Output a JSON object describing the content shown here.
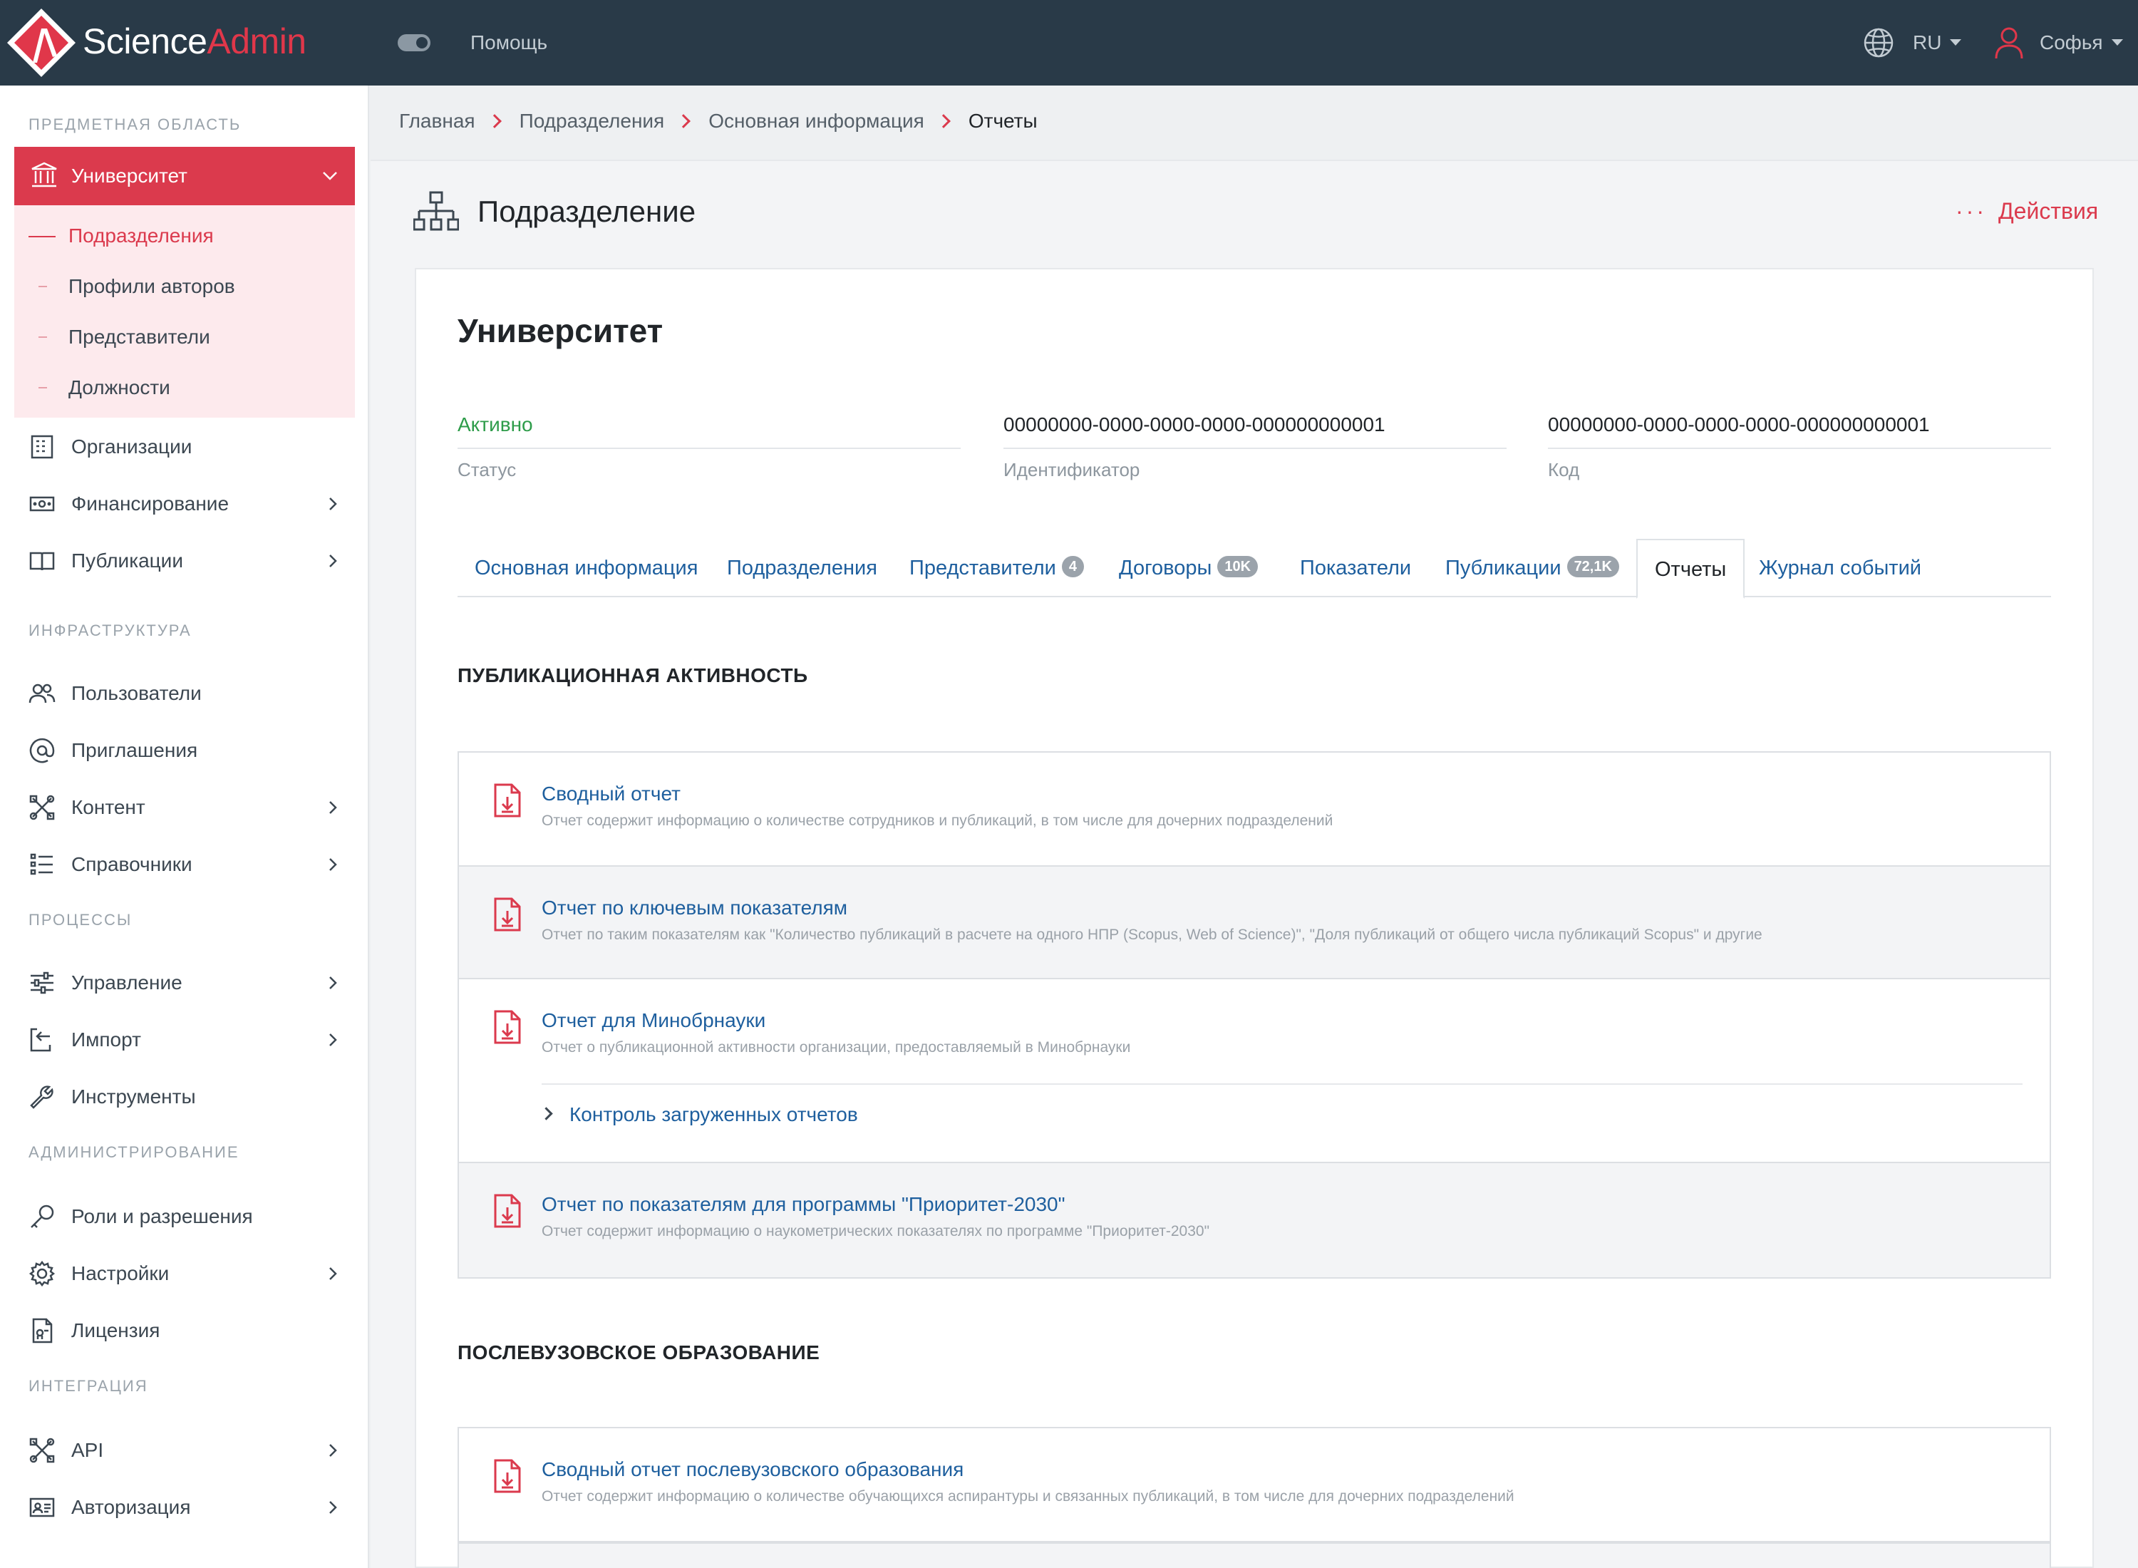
{
  "topbar": {
    "brand_part1": "Science",
    "brand_part2": "Admin",
    "help": "Помощь",
    "language": "RU",
    "user": "Софья"
  },
  "sidebar": {
    "sections": [
      "ПРЕДМЕТНАЯ ОБЛАСТЬ",
      "ИНФРАСТРУКТУРА",
      "ПРОЦЕССЫ",
      "АДМИНИСТРИРОВАНИЕ",
      "ИНТЕГРАЦИЯ"
    ],
    "active_group": {
      "label": "Университет",
      "icon": "institution-icon",
      "children": [
        "Подразделения",
        "Профили авторов",
        "Представители",
        "Должности"
      ]
    },
    "items": [
      {
        "label": "Организации",
        "icon": "building-icon"
      },
      {
        "label": "Финансирование",
        "icon": "money-icon"
      },
      {
        "label": "Публикации",
        "icon": "book-icon"
      },
      {
        "label": "Пользователи",
        "icon": "users-icon"
      },
      {
        "label": "Приглашения",
        "icon": "at-icon"
      },
      {
        "label": "Контент",
        "icon": "tools-icon"
      },
      {
        "label": "Справочники",
        "icon": "list-icon"
      },
      {
        "label": "Управление",
        "icon": "sliders-icon"
      },
      {
        "label": "Импорт",
        "icon": "import-icon"
      },
      {
        "label": "Инструменты",
        "icon": "wrench-icon"
      },
      {
        "label": "Роли и разрешения",
        "icon": "key-icon"
      },
      {
        "label": "Настройки",
        "icon": "gear-icon"
      },
      {
        "label": "Лицензия",
        "icon": "license-icon"
      },
      {
        "label": "API",
        "icon": "tools-icon"
      },
      {
        "label": "Авторизация",
        "icon": "id-card-icon"
      }
    ]
  },
  "breadcrumbs": [
    "Главная",
    "Подразделения",
    "Основная информация",
    "Отчеты"
  ],
  "page": {
    "title": "Подразделение",
    "actions": "Действия",
    "actions_dots": "···"
  },
  "entity": {
    "name": "Университет",
    "fields": [
      {
        "value": "Активно",
        "label": "Статус"
      },
      {
        "value": "00000000-0000-0000-0000-000000000001",
        "label": "Идентификатор"
      },
      {
        "value": "00000000-0000-0000-0000-000000000001",
        "label": "Код"
      }
    ]
  },
  "tabs": [
    {
      "label": "Основная информация",
      "badge": null
    },
    {
      "label": "Подразделения",
      "badge": null
    },
    {
      "label": "Представители",
      "badge": "4"
    },
    {
      "label": "Договоры",
      "badge": "10K"
    },
    {
      "label": "Показатели",
      "badge": null
    },
    {
      "label": "Публикации",
      "badge": "72,1K"
    },
    {
      "label": "Отчеты",
      "badge": null
    },
    {
      "label": "Журнал событий",
      "badge": null
    }
  ],
  "report_sections": [
    {
      "title": "ПУБЛИКАЦИОННАЯ АКТИВНОСТЬ",
      "reports": [
        {
          "title": "Сводный отчет",
          "desc": "Отчет содержит информацию о количестве сотрудников и публикаций, в том числе для дочерних подразделений"
        },
        {
          "title": "Отчет по ключевым показателям",
          "desc": "Отчет по таким показателям как \"Количество публикаций в расчете на одного НПР (Scopus, Web of Science)\", \"Доля публикаций от общего числа публикаций Scopus\" и другие"
        },
        {
          "title": "Отчет для Минобрнауки",
          "desc": "Отчет о публикационной активности организации, предоставляемый в Минобрнауки",
          "sublink": "Контроль загруженных отчетов"
        },
        {
          "title": "Отчет по показателям для программы \"Приоритет-2030\"",
          "desc": "Отчет содержит информацию о наукометрических показателях по программе \"Приоритет-2030\""
        }
      ]
    },
    {
      "title": "ПОСЛЕВУЗОВСКОЕ ОБРАЗОВАНИЕ",
      "reports": [
        {
          "title": "Сводный отчет послевузовского образования",
          "desc": "Отчет содержит информацию о количестве обучающихся аспирантуры и связанных публикаций, в том числе для дочерних подразделений"
        }
      ]
    }
  ],
  "colors": {
    "accent": "#db3a4d",
    "topbar": "#293a48",
    "link": "#1e5f9e",
    "status_active": "#2e9c4a"
  }
}
